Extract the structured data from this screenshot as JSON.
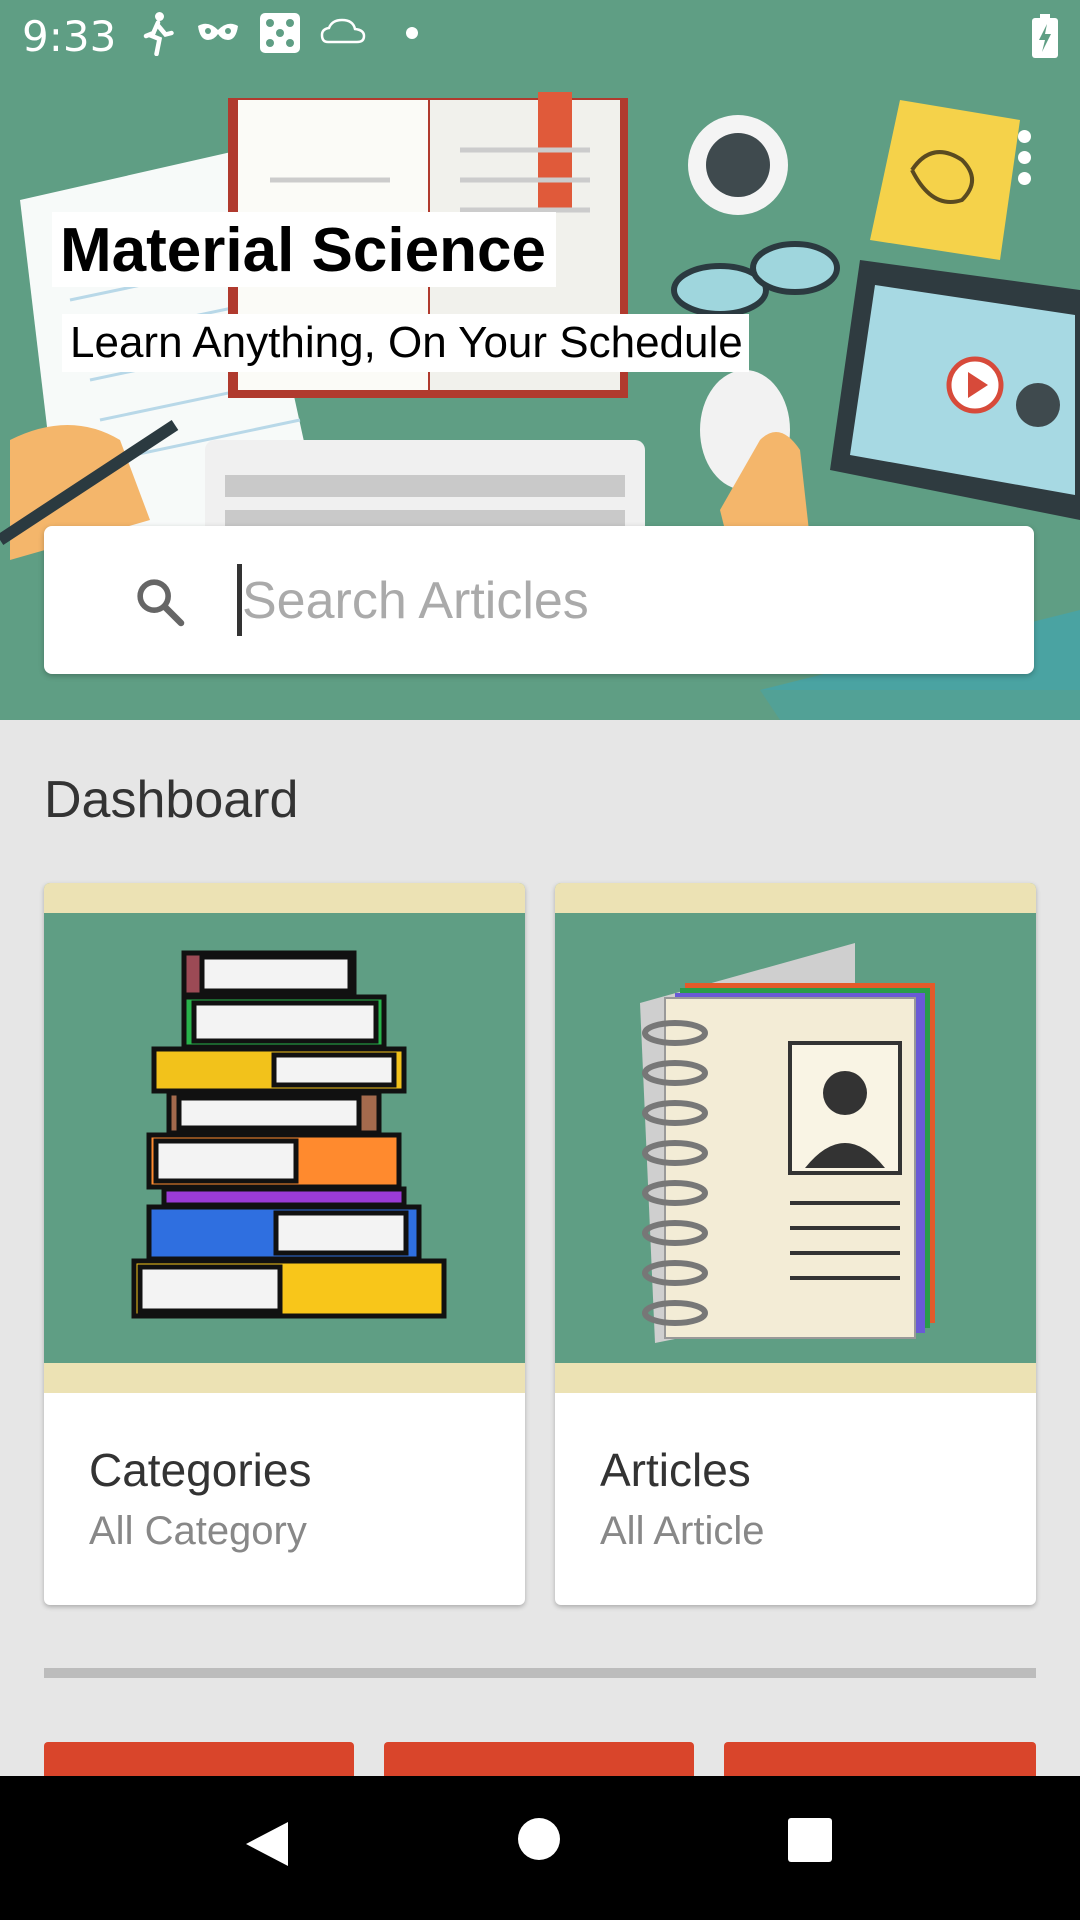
{
  "status_bar": {
    "time": "9:33",
    "icons": [
      "walk-icon",
      "mask-icon",
      "dice-icon",
      "cloud-icon",
      "dot-icon"
    ],
    "battery_icon": "battery-charging-icon"
  },
  "header": {
    "title": "Material Science",
    "subtitle": "Learn Anything, On Your Schedule",
    "menu_icon": "more-vert-icon",
    "background_color": "#5f9e84"
  },
  "search": {
    "placeholder": "Search Articles",
    "value": ""
  },
  "dashboard": {
    "title": "Dashboard",
    "cards": [
      {
        "title": "Categories",
        "subtitle": "All Category",
        "image": "book-stack-illustration"
      },
      {
        "title": "Articles",
        "subtitle": "All Article",
        "image": "notebook-illustration"
      }
    ]
  },
  "colors": {
    "accent_green": "#5f9e84",
    "tile_red": "#d9452b"
  },
  "navigation": {
    "buttons": [
      "back-icon",
      "home-icon",
      "recents-icon"
    ]
  }
}
